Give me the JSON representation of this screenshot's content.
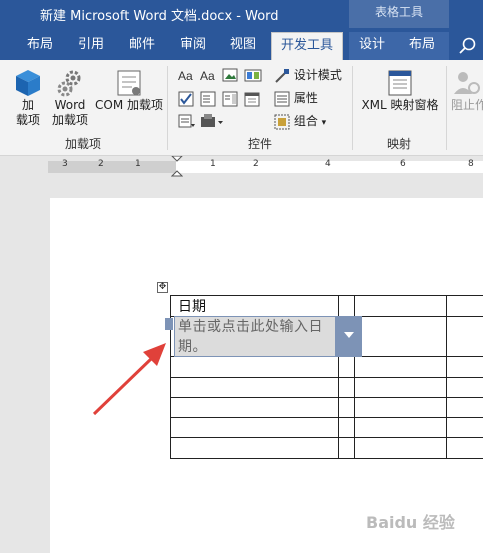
{
  "window": {
    "title": "新建 Microsoft Word 文档.docx  -  Word",
    "context_group": "表格工具"
  },
  "tabs": [
    {
      "label": "布局"
    },
    {
      "label": "引用"
    },
    {
      "label": "邮件"
    },
    {
      "label": "审阅"
    },
    {
      "label": "视图"
    },
    {
      "label": "开发工具",
      "active": true
    },
    {
      "label": "设计",
      "contextual": true
    },
    {
      "label": "布局",
      "contextual": true
    }
  ],
  "ribbon": {
    "addins": {
      "btn_addins": "加\n载项",
      "btn_word_addins": "Word\n加载项",
      "btn_com_addins": "COM 加载项",
      "label": "加载项"
    },
    "controls": {
      "design_mode": "设计模式",
      "properties": "属性",
      "group": "组合",
      "label": "控件"
    },
    "mapping": {
      "xml_mapping": "XML 映射窗格",
      "label": "映射"
    },
    "protect": {
      "block_authors": "阻止作"
    }
  },
  "ruler": {
    "left_numbers": [
      "3",
      "2",
      "1",
      "1"
    ],
    "right_numbers": [
      "2",
      "4",
      "6",
      "8"
    ]
  },
  "document": {
    "table_header": "日期",
    "date_placeholder": "单击或点击此处输入日期。"
  },
  "watermark": "Baidu 经验",
  "colors": {
    "ribbon_blue": "#2b579a",
    "content_control": "#7d93b6",
    "arrow_red": "#e0413a"
  }
}
